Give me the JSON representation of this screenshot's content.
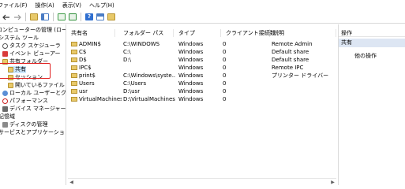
{
  "menu": [
    "ファイル(F)",
    "操作(A)",
    "表示(V)",
    "ヘルプ(H)"
  ],
  "toolbar_icons": [
    "back-icon",
    "forward-icon",
    "folder-icon",
    "console-tree-icon",
    "refresh-icon",
    "export-icon",
    "help-icon",
    "properties-icon",
    "new-share-icon"
  ],
  "tree": [
    {
      "label": "コンピューターの管理 (ローカル)",
      "icon": "computer-icon"
    },
    {
      "label": "システム ツール",
      "icon": "tools-icon"
    },
    {
      "label": "タスク スケジューラ",
      "icon": "clock-icon"
    },
    {
      "label": "イベント ビューアー",
      "icon": "event-viewer-icon"
    },
    {
      "label": "共有フォルダー",
      "icon": "shared-folder-icon"
    },
    {
      "label": "共有",
      "icon": "share-icon"
    },
    {
      "label": "セッション",
      "icon": "session-icon"
    },
    {
      "label": "開いているファイル",
      "icon": "open-files-icon"
    },
    {
      "label": "ローカル ユーザーとグループ",
      "icon": "users-icon"
    },
    {
      "label": "パフォーマンス",
      "icon": "performance-icon"
    },
    {
      "label": "デバイス マネージャー",
      "icon": "device-manager-icon"
    },
    {
      "label": "記憶域",
      "icon": "storage-icon"
    },
    {
      "label": "ディスクの管理",
      "icon": "disk-icon"
    },
    {
      "label": "サービスとアプリケーション",
      "icon": "services-icon"
    }
  ],
  "list": {
    "columns": [
      "共有名",
      "フォルダー パス",
      "タイプ",
      "クライアント接続数",
      "説明"
    ],
    "rows": [
      [
        "ADMIN$",
        "C:\\WINDOWS",
        "Windows",
        "0",
        "Remote Admin"
      ],
      [
        "C$",
        "C:\\",
        "Windows",
        "0",
        "Default share"
      ],
      [
        "D$",
        "D:\\",
        "Windows",
        "0",
        "Default share"
      ],
      [
        "IPC$",
        "",
        "Windows",
        "0",
        "Remote IPC"
      ],
      [
        "print$",
        "C:\\Windows\\syste...",
        "Windows",
        "0",
        "プリンター ドライバー"
      ],
      [
        "Users",
        "C:\\Users",
        "Windows",
        "0",
        ""
      ],
      [
        "usr",
        "D:\\usr",
        "Windows",
        "0",
        ""
      ],
      [
        "VirtualMachines",
        "D:\\VirtualMachines",
        "Windows",
        "0",
        ""
      ]
    ]
  },
  "actions": {
    "title": "操作",
    "group": "共有",
    "items": [
      "他の操作"
    ]
  },
  "colors": {
    "highlight": "#e02020",
    "selected": "#cce8ff",
    "action_group": "#dde6f3"
  }
}
